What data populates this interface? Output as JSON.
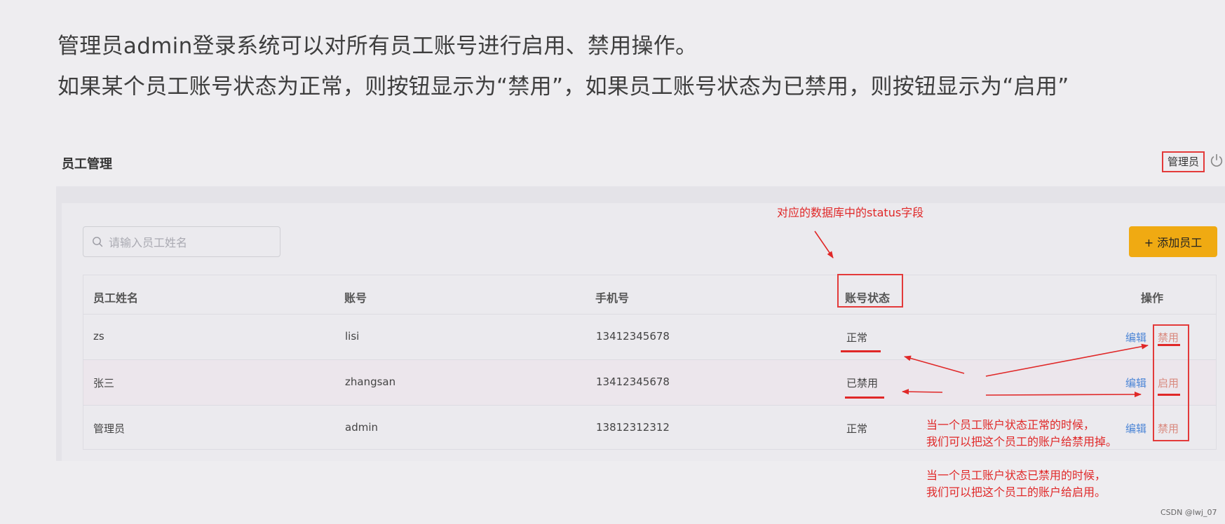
{
  "intro": {
    "line1": "管理员admin登录系统可以对所有员工账号进行启用、禁用操作。",
    "line2": "如果某个员工账号状态为正常，则按钮显示为“禁用”，如果员工账号状态为已禁用，则按钮显示为“启用”"
  },
  "header": {
    "title": "员工管理",
    "user": "管理员",
    "logout_icon": "power-icon"
  },
  "search": {
    "placeholder": "请输入员工姓名",
    "value": "",
    "icon": "search-icon"
  },
  "toolbar": {
    "add_label": "+ 添加员工"
  },
  "table": {
    "columns": [
      "员工姓名",
      "账号",
      "手机号",
      "账号状态",
      "操作"
    ],
    "rows": [
      {
        "name": "zs",
        "account": "lisi",
        "phone": "13412345678",
        "status": "正常",
        "edit": "编辑",
        "toggle": "禁用"
      },
      {
        "name": "张三",
        "account": "zhangsan",
        "phone": "13412345678",
        "status": "已禁用",
        "edit": "编辑",
        "toggle": "启用"
      },
      {
        "name": "管理员",
        "account": "admin",
        "phone": "13812312312",
        "status": "正常",
        "edit": "编辑",
        "toggle": "禁用"
      }
    ]
  },
  "annotations": {
    "status_field": "对应的数据库中的status字段",
    "normal_line1": "当一个员工账户状态正常的时候，",
    "normal_line2": "我们可以把这个员工的账户给禁用掉。",
    "disabled_line1": "当一个员工账户状态已禁用的时候，",
    "disabled_line2": "我们可以把这个员工的账户给启用。",
    "color": "#e02828"
  },
  "colors": {
    "accent": "#f0aa12",
    "link": "#4d86d6",
    "toggle": "#d98a7f"
  },
  "watermark": "CSDN @lwj_07"
}
